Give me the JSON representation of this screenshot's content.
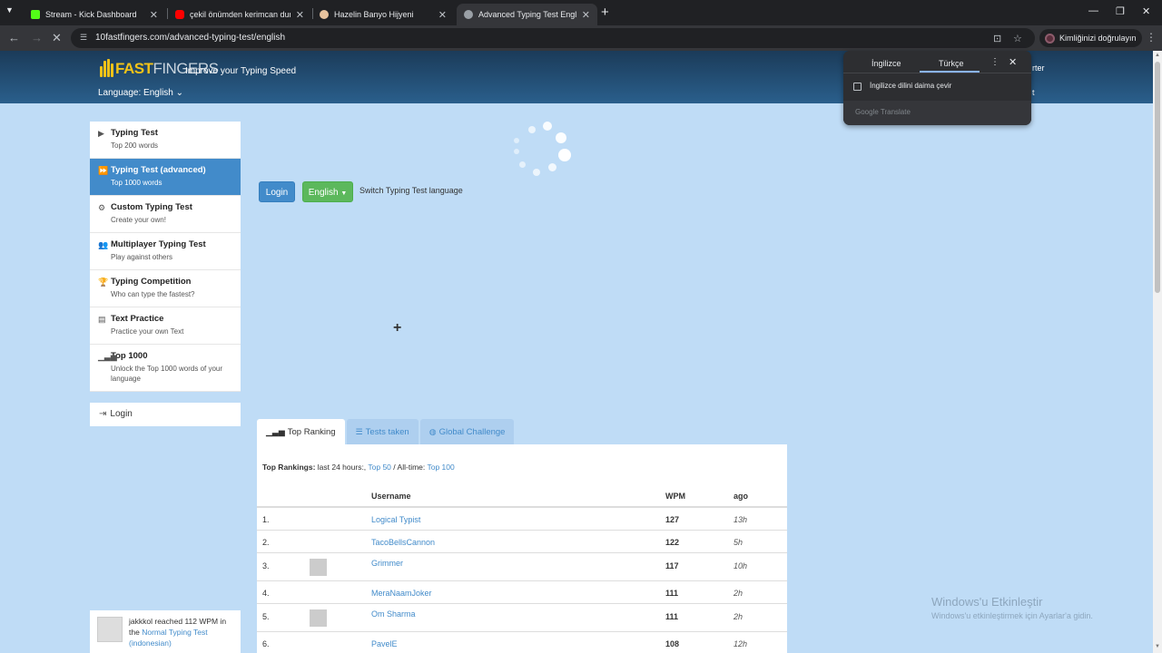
{
  "browser": {
    "tabs": [
      {
        "title": "Stream - Kick Dashboard",
        "favicon_color": "#53fc18"
      },
      {
        "title": "çekil önümden kerimcan durmaz",
        "favicon_color": "#ff0000"
      },
      {
        "title": "Hazelin Banyo Hijyeni",
        "favicon_color": "#e8c39e"
      },
      {
        "title": "Advanced Typing Test English -",
        "favicon_color": "#9aa0a6"
      }
    ],
    "new_tab": "+",
    "url": "10fastfingers.com/advanced-typing-test/english",
    "profile_label": "Kimliğinizi doğrulayın"
  },
  "header": {
    "logo_prefix": "10",
    "logo_fast": "FAST",
    "logo_fingers": "FINGERS",
    "tagline": "Improve your Typing Speed",
    "language_label": "Language: English",
    "right_text_1": "rter",
    "right_text_2": "t"
  },
  "sidebar": {
    "items": [
      {
        "title": "Typing Test",
        "subtitle": "Top 200 words",
        "icon": "play-icon"
      },
      {
        "title": "Typing Test (advanced)",
        "subtitle": "Top 1000 words",
        "icon": "forward-icon"
      },
      {
        "title": "Custom Typing Test",
        "subtitle": "Create your own!",
        "icon": "gears-icon"
      },
      {
        "title": "Multiplayer Typing Test",
        "subtitle": "Play against others",
        "icon": "users-icon"
      },
      {
        "title": "Typing Competition",
        "subtitle": "Who can type the fastest?",
        "icon": "trophy-icon"
      },
      {
        "title": "Text Practice",
        "subtitle": "Practice your own Text",
        "icon": "document-icon"
      },
      {
        "title": "Top 1000",
        "subtitle": "Unlock the Top 1000 words of your language",
        "icon": "signal-icon"
      }
    ],
    "login_label": "Login"
  },
  "activity": {
    "user": "jakkkol",
    "text1": "reached",
    "wpm": "112 WPM",
    "text2": "in the",
    "link": "Normal Typing Test (indonesian)"
  },
  "main": {
    "login_button": "Login",
    "language_button": "English",
    "switch_note": "Switch Typing Test language"
  },
  "ranking": {
    "tabs": [
      "Top Ranking",
      "Tests taken",
      "Global Challenge"
    ],
    "header_label": "Top Rankings:",
    "header_last": "last 24 hours:,",
    "header_top50": "Top 50",
    "header_sep": "/ All-time:",
    "header_top100": "Top 100",
    "columns": {
      "username": "Username",
      "wpm": "WPM",
      "ago": "ago"
    },
    "rows": [
      {
        "rank": "1.",
        "username": "Logical Typist",
        "wpm": "127",
        "ago": "13h",
        "avatar": false
      },
      {
        "rank": "2.",
        "username": "TacoBellsCannon",
        "wpm": "122",
        "ago": "5h",
        "avatar": false
      },
      {
        "rank": "3.",
        "username": "Grimmer",
        "wpm": "117",
        "ago": "10h",
        "avatar": true
      },
      {
        "rank": "4.",
        "username": "MeraNaamJoker",
        "wpm": "111",
        "ago": "2h",
        "avatar": false
      },
      {
        "rank": "5.",
        "username": "Om Sharma",
        "wpm": "111",
        "ago": "2h",
        "avatar": true
      },
      {
        "rank": "6.",
        "username": "PavelE",
        "wpm": "108",
        "ago": "12h",
        "avatar": false
      }
    ]
  },
  "translate_popup": {
    "tab_source": "İngilizce",
    "tab_target": "Türkçe",
    "checkbox_label": "İngilizce dilini daima çevir",
    "footer": "Google Translate"
  },
  "watermark": {
    "line1": "Windows'u Etkinleştir",
    "line2": "Windows'u etkinleştirmek için Ayarlar'a gidin."
  }
}
